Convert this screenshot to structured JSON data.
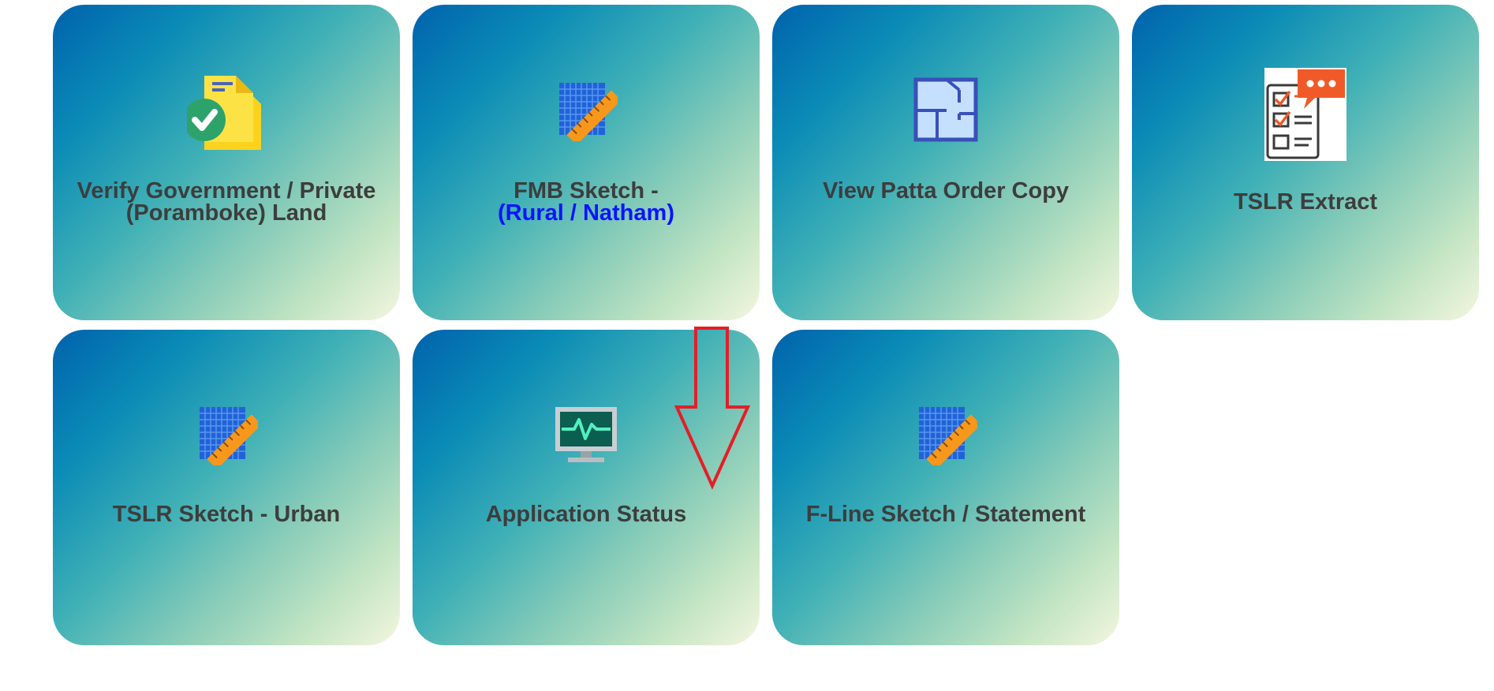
{
  "cards": [
    {
      "title_line1": "Verify Government / Private",
      "title_line2": "(Poramboke) Land",
      "icon": "document-check-icon"
    },
    {
      "title_line1": "FMB Sketch -",
      "title_line2": "(Rural / Natham)",
      "icon": "grid-ruler-icon"
    },
    {
      "title": "View Patta Order Copy",
      "icon": "floor-plan-icon"
    },
    {
      "title": "TSLR Extract",
      "icon": "checklist-chat-icon"
    },
    {
      "title": "TSLR Sketch - Urban",
      "icon": "grid-ruler-icon"
    },
    {
      "title": "Application Status",
      "icon": "monitor-pulse-icon"
    },
    {
      "title": "F-Line Sketch / Statement",
      "icon": "grid-ruler-icon"
    }
  ],
  "annotation": {
    "icon": "down-arrow-icon",
    "color": "#e41e26"
  }
}
